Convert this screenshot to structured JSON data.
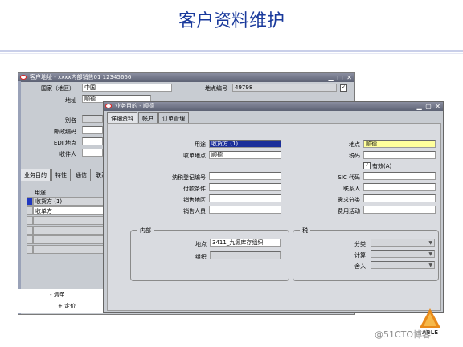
{
  "slide": {
    "title": "客户资料维护"
  },
  "back_window": {
    "title": "客户地址 - xxxx内部销售01 12345666",
    "country_label": "国家（地区）",
    "country_value": "中国",
    "site_number_label": "地点编号",
    "site_number_value": "49798",
    "address_label": "地址",
    "address_value": "顺德",
    "alias_label": "别名",
    "postal_label": "邮政编码",
    "edi_label": "EDI 地点",
    "recipient_label": "收件人",
    "tabs": [
      "业务目的",
      "特性",
      "通信",
      "联系"
    ],
    "usage_header": "用途",
    "usage_rows": [
      "收货方 (1)",
      "收单方",
      "",
      "",
      "",
      ""
    ],
    "tree_items": [
      "清单",
      "定价"
    ]
  },
  "front_window": {
    "title": "业务目的 - 顺德",
    "tabs": [
      "详细资料",
      "帐户",
      "订单管理"
    ],
    "usage_label": "用途",
    "usage_value": "收货方 (1)",
    "bill_site_label": "收单地点",
    "bill_site_value": "顺德",
    "location_label": "地点",
    "location_value": "顺德",
    "tax_code_label": "税码",
    "active_label": "有效(A)",
    "active_checked": true,
    "tax_reg_label": "纳税登记编号",
    "payment_terms_label": "付款条件",
    "sales_region_label": "销售地区",
    "salesperson_label": "销售人员",
    "sic_label": "SIC 代码",
    "contact_label": "联系人",
    "demand_class_label": "需求分类",
    "freight_label": "费用活动",
    "internal_group": {
      "title": "内部",
      "location_label": "地点",
      "location_value": "3411_九源库存组织",
      "org_label": "组织"
    },
    "tax_group": {
      "title": "税",
      "class_label": "分类",
      "calc_label": "计算",
      "rounding_label": "舍入"
    }
  },
  "footer": {
    "logo_text": "ABLE",
    "watermark": "@51CTO博客"
  }
}
